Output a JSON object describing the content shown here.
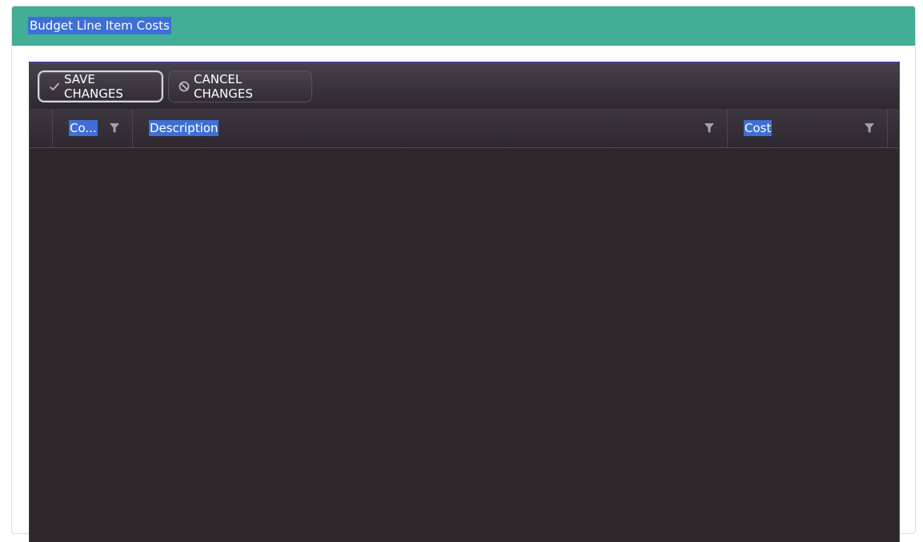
{
  "panel": {
    "title": "Budget Line Item Costs"
  },
  "toolbar": {
    "save_label": "SAVE CHANGES",
    "cancel_label": "CANCEL CHANGES"
  },
  "columns": [
    {
      "label": "Co..."
    },
    {
      "label": "Description"
    },
    {
      "label": "Cost"
    }
  ],
  "icons": {
    "save": "checkmark-icon",
    "cancel": "prohibit-icon",
    "filter": "filter-icon"
  },
  "colors": {
    "header_accent": "#43ae96",
    "grid_background": "#2e272e",
    "selection_highlight": "#3d6fd6"
  }
}
